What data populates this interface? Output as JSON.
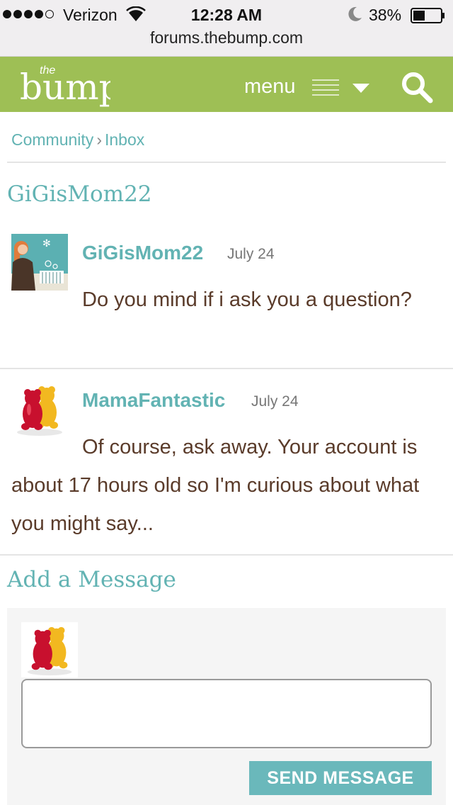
{
  "status_bar": {
    "carrier": "Verizon",
    "time": "12:28 AM",
    "battery": "38%"
  },
  "browser": {
    "url": "forums.thebump.com"
  },
  "header": {
    "logo_text": "the bump",
    "menu_label": "menu"
  },
  "breadcrumb": {
    "items": [
      "Community",
      "Inbox"
    ],
    "separator": "›"
  },
  "thread": {
    "title": "GiGisMom22"
  },
  "messages": [
    {
      "author": "GiGisMom22",
      "date": "July 24",
      "body": "Do you mind if i ask you a question?",
      "avatar": "mom-nursery-avatar"
    },
    {
      "author": "MamaFantastic",
      "date": "July 24",
      "body": "Of course, ask away.  Your account is about 17 hours old so I'm curious about what you might say...",
      "avatar": "gummy-bears-avatar"
    }
  ],
  "compose": {
    "title": "Add a Message",
    "placeholder": "",
    "send_label": "SEND MESSAGE",
    "avatar": "gummy-bears-avatar"
  },
  "colors": {
    "header_green": "#9ebf55",
    "teal": "#62b3b3",
    "button_teal": "#6ab8bb",
    "body_text": "#5a3b2a"
  }
}
